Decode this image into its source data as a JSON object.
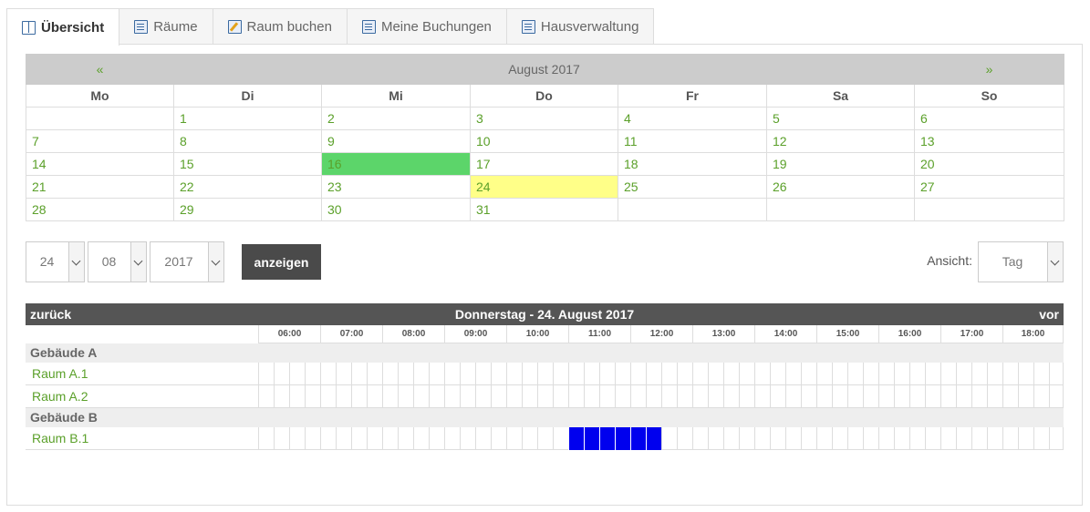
{
  "tabs": [
    {
      "label": "Übersicht",
      "icon": "book-icon",
      "active": true
    },
    {
      "label": "Räume",
      "icon": "document-icon",
      "active": false
    },
    {
      "label": "Raum buchen",
      "icon": "edit-icon",
      "active": false
    },
    {
      "label": "Meine Buchungen",
      "icon": "document-icon",
      "active": false
    },
    {
      "label": "Hausverwaltung",
      "icon": "document-icon",
      "active": false
    }
  ],
  "calendar": {
    "prev": "«",
    "next": "»",
    "month_label": "August 2017",
    "weekdays": [
      "Mo",
      "Di",
      "Mi",
      "Do",
      "Fr",
      "Sa",
      "So"
    ],
    "weeks": [
      [
        "",
        "1",
        "2",
        "3",
        "4",
        "5",
        "6"
      ],
      [
        "7",
        "8",
        "9",
        "10",
        "11",
        "12",
        "13"
      ],
      [
        "14",
        "15",
        "16",
        "17",
        "18",
        "19",
        "20"
      ],
      [
        "21",
        "22",
        "23",
        "24",
        "25",
        "26",
        "27"
      ],
      [
        "28",
        "29",
        "30",
        "31",
        "",
        "",
        ""
      ]
    ],
    "selected_day": "16",
    "today_day": "24",
    "colors": {
      "selected": "#5cd56a",
      "today": "#ffff88",
      "link": "#5ba02a"
    }
  },
  "controls": {
    "day": "24",
    "month": "08",
    "year": "2017",
    "show_button": "anzeigen",
    "view_label": "Ansicht:",
    "view_value": "Tag"
  },
  "schedule": {
    "back": "zurück",
    "title": "Donnerstag - 24. August 2017",
    "forward": "vor",
    "hours": [
      "06:00",
      "07:00",
      "08:00",
      "09:00",
      "10:00",
      "11:00",
      "12:00",
      "13:00",
      "14:00",
      "15:00",
      "16:00",
      "17:00",
      "18:00"
    ],
    "groups": [
      {
        "name": "Gebäude A",
        "rooms": [
          {
            "name": "Raum A.1",
            "booked": []
          },
          {
            "name": "Raum A.2",
            "booked": []
          }
        ]
      },
      {
        "name": "Gebäude B",
        "rooms": [
          {
            "name": "Raum B.1",
            "booked": [
              20,
              21,
              22,
              23,
              24,
              25
            ]
          }
        ]
      }
    ],
    "booking_color": "#0000ee"
  }
}
